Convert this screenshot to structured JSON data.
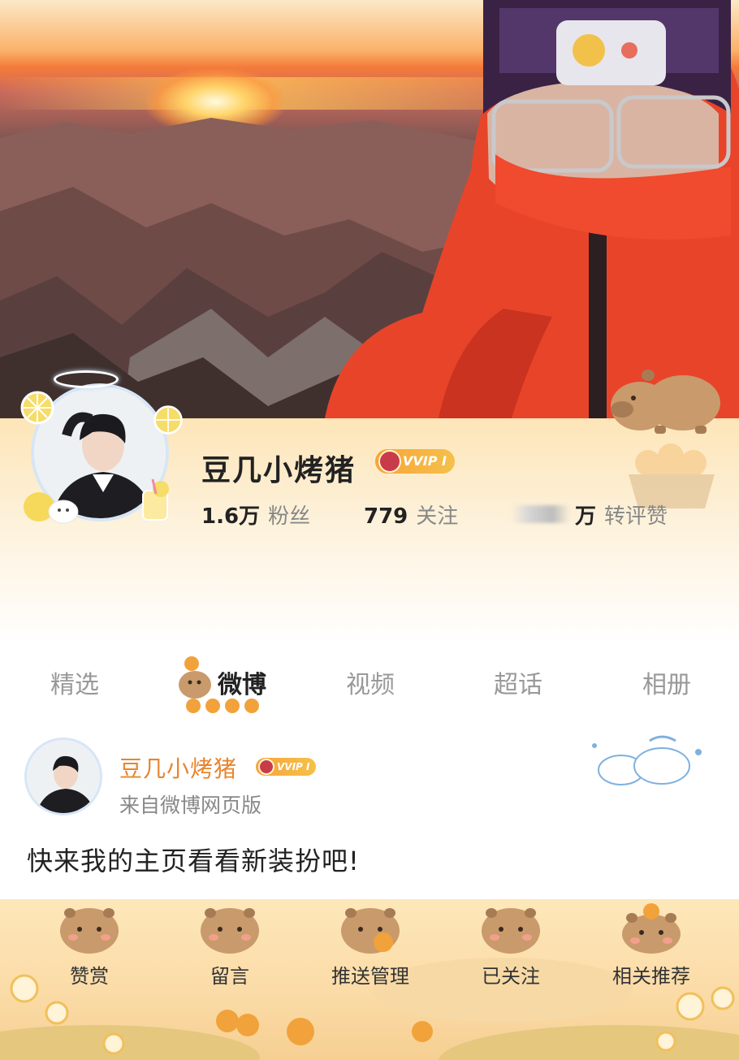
{
  "profile": {
    "username": "豆几小烤猪",
    "vip_badge": "VVIP Ⅰ",
    "stats": {
      "followers_value": "1.6万",
      "followers_label": "粉丝",
      "following_value": "779",
      "following_label": "关注",
      "likes_unit": "万",
      "likes_label": "转评赞"
    }
  },
  "tabs": [
    {
      "label": "精选"
    },
    {
      "label": "微博",
      "active": true
    },
    {
      "label": "视频"
    },
    {
      "label": "超话"
    },
    {
      "label": "相册"
    }
  ],
  "post": {
    "author": "豆几小烤猪",
    "vip_badge": "VVIP Ⅰ",
    "source": "来自微博网页版",
    "text": "快来我的主页看看新装扮吧!"
  },
  "actions": [
    {
      "label": "赞赏"
    },
    {
      "label": "留言"
    },
    {
      "label": "推送管理"
    },
    {
      "label": "已关注"
    },
    {
      "label": "相关推荐"
    }
  ],
  "colors": {
    "accent_orange": "#e8852e",
    "header_cream": "#fde5b8",
    "bottom_bar": "#fbdca8"
  }
}
